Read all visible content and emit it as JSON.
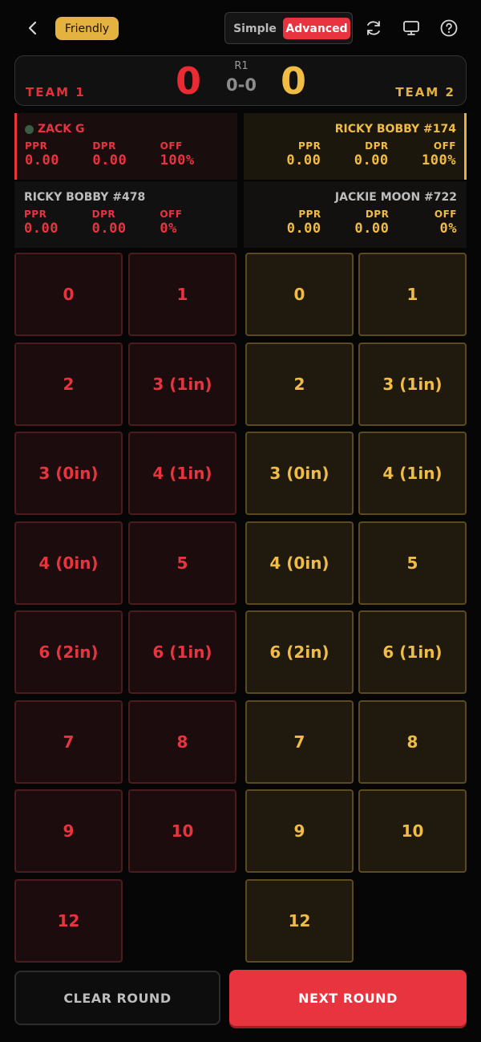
{
  "header": {
    "mode_badge": "Friendly",
    "toggle": {
      "simple": "Simple",
      "advanced": "Advanced",
      "selected": "Advanced"
    },
    "icons": [
      "chevron-left-icon",
      "refresh-icon",
      "monitor-icon",
      "help-icon"
    ]
  },
  "scoreboard": {
    "team1_label": "TEAM 1",
    "team2_label": "TEAM 2",
    "team1_score": "0",
    "team2_score": "0",
    "round": "R1",
    "games": "0-0"
  },
  "players": {
    "red_top": {
      "name": "ZACK G",
      "ppr_label": "PPR",
      "ppr": "0.00",
      "dpr_label": "DPR",
      "dpr": "0.00",
      "off_label": "OFF",
      "off": "100%"
    },
    "gold_top": {
      "name": "RICKY BOBBY #174",
      "ppr_label": "PPR",
      "ppr": "0.00",
      "dpr_label": "DPR",
      "dpr": "0.00",
      "off_label": "OFF",
      "off": "100%"
    },
    "red_bottom": {
      "name": "RICKY BOBBY #478",
      "ppr_label": "PPR",
      "ppr": "0.00",
      "dpr_label": "DPR",
      "dpr": "0.00",
      "off_label": "OFF",
      "off": "0%"
    },
    "gold_bottom": {
      "name": "JACKIE MOON #722",
      "ppr_label": "PPR",
      "ppr": "0.00",
      "dpr_label": "DPR",
      "dpr": "0.00",
      "off_label": "OFF",
      "off": "0%"
    }
  },
  "score_buttons": {
    "team1": [
      "0",
      "1",
      "2",
      "3 (1in)",
      "3 (0in)",
      "4 (1in)",
      "4 (0in)",
      "5",
      "6 (2in)",
      "6 (1in)",
      "7",
      "8",
      "9",
      "10",
      "12"
    ],
    "team2": [
      "0",
      "1",
      "2",
      "3 (1in)",
      "3 (0in)",
      "4 (1in)",
      "4 (0in)",
      "5",
      "6 (2in)",
      "6 (1in)",
      "7",
      "8",
      "9",
      "10",
      "12"
    ]
  },
  "actions": {
    "clear": "CLEAR ROUND",
    "next": "NEXT ROUND"
  },
  "colors": {
    "team1": "#e8343f",
    "team2": "#f1bc43",
    "badge": "#e3b23f"
  }
}
